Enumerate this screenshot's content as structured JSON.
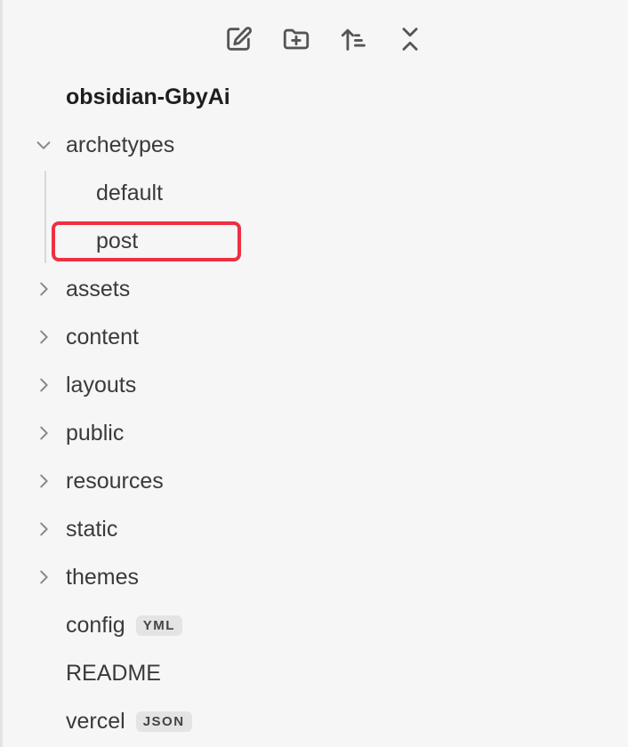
{
  "toolbar": {
    "buttons": [
      {
        "name": "new-note",
        "icon": "edit-icon"
      },
      {
        "name": "new-folder",
        "icon": "folder-plus-icon"
      },
      {
        "name": "sort",
        "icon": "sort-icon"
      },
      {
        "name": "collapse-all",
        "icon": "collapse-icon"
      }
    ]
  },
  "vault": {
    "name": "obsidian-GbyAi"
  },
  "tree": {
    "archetypes": {
      "label": "archetypes",
      "expanded": true,
      "children": [
        {
          "label": "default"
        },
        {
          "label": "post",
          "highlighted": true
        }
      ]
    },
    "folders": [
      {
        "label": "assets"
      },
      {
        "label": "content"
      },
      {
        "label": "layouts"
      },
      {
        "label": "public"
      },
      {
        "label": "resources"
      },
      {
        "label": "static"
      },
      {
        "label": "themes"
      }
    ],
    "files": [
      {
        "label": "config",
        "badge": "YML"
      },
      {
        "label": "README",
        "badge": ""
      },
      {
        "label": "vercel",
        "badge": "JSON"
      }
    ]
  },
  "colors": {
    "background": "#f6f6f6",
    "highlight_border": "#ee3040",
    "badge_bg": "#e4e4e4"
  }
}
